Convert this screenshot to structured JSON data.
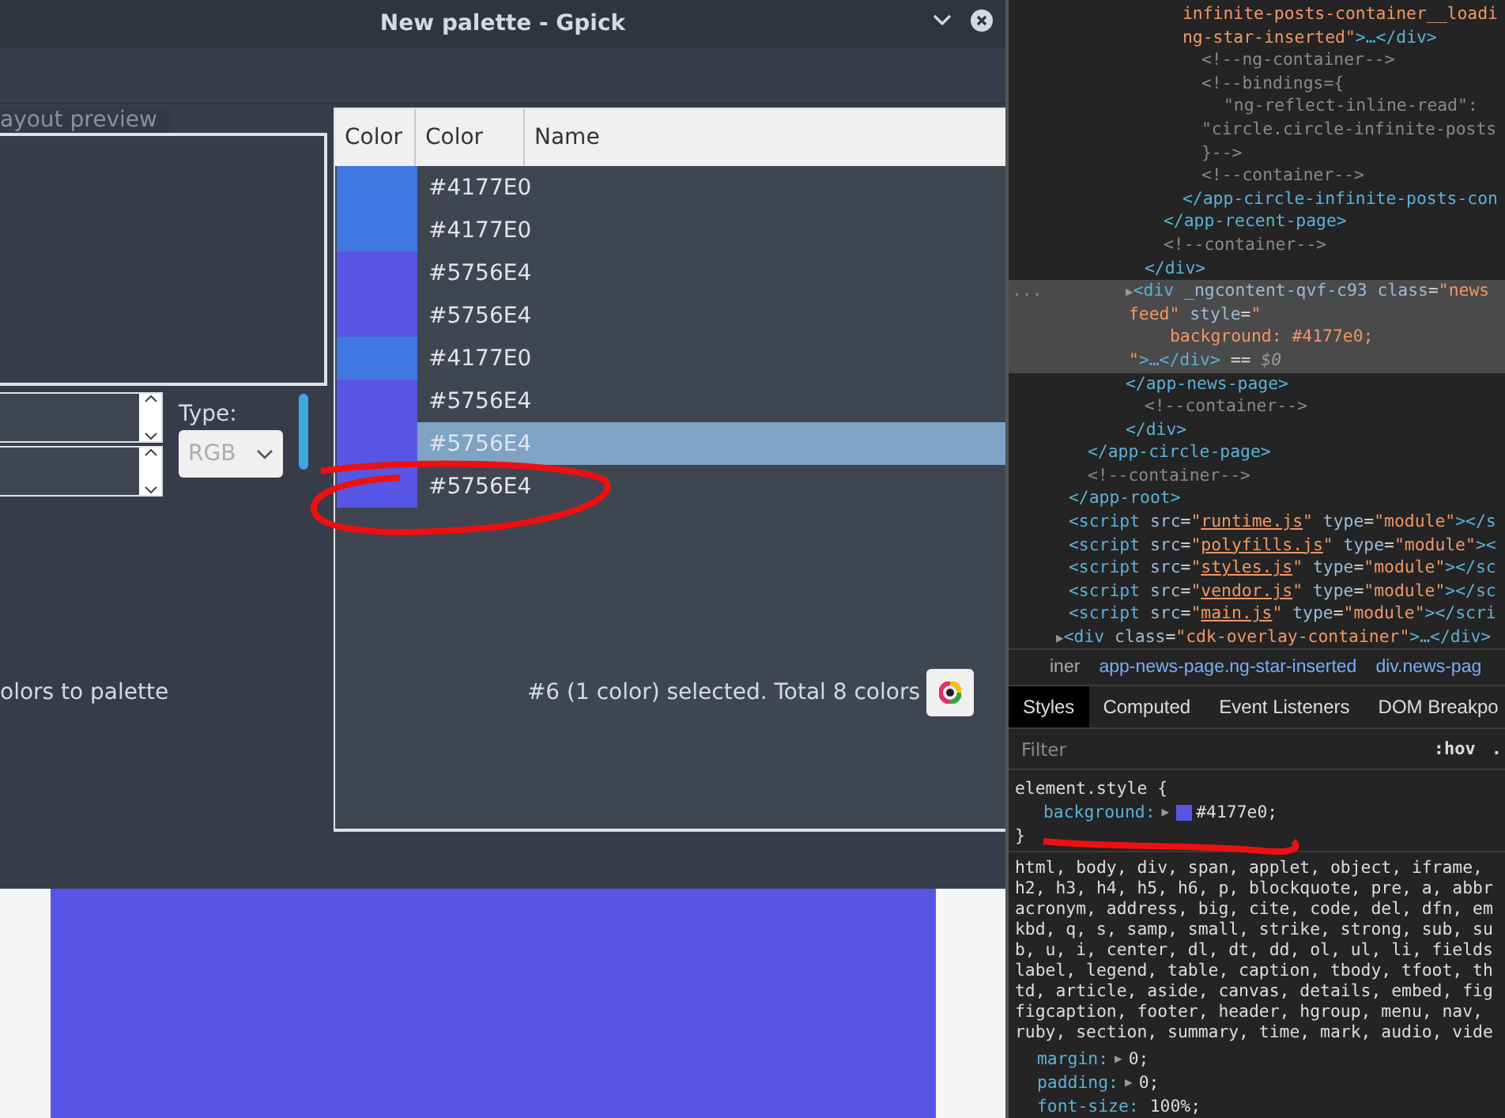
{
  "gpick": {
    "title": "New palette - Gpick",
    "preview_tab": {
      "label": "ayout preview",
      "selected": true
    },
    "type_label": "Type:",
    "type_select": {
      "value": "RGB",
      "disabled": true
    },
    "table": {
      "columns": [
        "Color",
        "Color",
        "Name"
      ],
      "rows": [
        {
          "color": "#4177e0",
          "value": "#4177E0",
          "selected": false
        },
        {
          "color": "#4177e0",
          "value": "#4177E0",
          "selected": false
        },
        {
          "color": "#5756e4",
          "value": "#5756E4",
          "selected": false
        },
        {
          "color": "#5756e4",
          "value": "#5756E4",
          "selected": false
        },
        {
          "color": "#4177e0",
          "value": "#4177E0",
          "selected": false
        },
        {
          "color": "#5756e4",
          "value": "#5756E4",
          "selected": false
        },
        {
          "color": "#5756e4",
          "value": "#5756E4",
          "selected": true
        },
        {
          "color": "#5756e4",
          "value": "#5756E4",
          "selected": false
        }
      ]
    },
    "status_left": "olors to palette",
    "status_right": "#6 (1 color) selected. Total 8 colors"
  },
  "devtools": {
    "elements": [
      {
        "tokens": [
          {
            "kind": "value",
            "text": "infinite-posts-container__loadi"
          }
        ]
      },
      {
        "tokens": [
          {
            "kind": "value",
            "text": "ng-star-inserted\""
          },
          {
            "kind": "tag",
            "text": ">…</div>"
          }
        ]
      },
      {
        "tokens": [
          {
            "kind": "comment",
            "text": "<!--ng-container-->"
          }
        ]
      },
      {
        "tokens": [
          {
            "kind": "comment",
            "text": "<!--bindings={"
          }
        ]
      },
      {
        "tokens": [
          {
            "kind": "comment",
            "text": "\"ng-reflect-inline-read\":"
          }
        ]
      },
      {
        "tokens": [
          {
            "kind": "comment",
            "text": "\"circle.circle-infinite-posts"
          }
        ]
      },
      {
        "tokens": [
          {
            "kind": "comment",
            "text": "}-->"
          }
        ]
      },
      {
        "tokens": [
          {
            "kind": "comment",
            "text": "<!--container-->"
          }
        ]
      },
      {
        "tokens": [
          {
            "kind": "tag",
            "text": "</app-circle-infinite-posts-con"
          }
        ]
      },
      {
        "tokens": [
          {
            "kind": "tag",
            "text": "</app-recent-page>"
          }
        ]
      },
      {
        "tokens": [
          {
            "kind": "comment",
            "text": "<!--container-->"
          }
        ]
      },
      {
        "tokens": [
          {
            "kind": "tag",
            "text": "</div>"
          }
        ]
      },
      {
        "selected": true,
        "gutter": "...",
        "tokens": [
          {
            "kind": "arrow",
            "text": "▶"
          },
          {
            "kind": "tag",
            "text": "<div "
          },
          {
            "kind": "attr",
            "text": "_ngcontent-qvf-c93 class"
          },
          {
            "kind": "plain",
            "text": "="
          },
          {
            "kind": "value",
            "text": "\"news"
          }
        ]
      },
      {
        "selected": true,
        "tokens": [
          {
            "kind": "value",
            "text": "feed\""
          },
          {
            "kind": "attr",
            "text": " style"
          },
          {
            "kind": "plain",
            "text": "="
          },
          {
            "kind": "value",
            "text": "\""
          }
        ]
      },
      {
        "selected": true,
        "tokens": [
          {
            "kind": "value",
            "text": "background: #4177e0;"
          }
        ]
      },
      {
        "selected": true,
        "tokens": [
          {
            "kind": "value",
            "text": "\""
          },
          {
            "kind": "tag",
            "text": ">…</div>"
          },
          {
            "kind": "plain",
            "text": " == "
          },
          {
            "kind": "dollar",
            "text": "$0"
          }
        ]
      },
      {
        "tokens": [
          {
            "kind": "tag",
            "text": "</app-news-page>"
          }
        ]
      },
      {
        "tokens": [
          {
            "kind": "comment",
            "text": "<!--container-->"
          }
        ]
      },
      {
        "tokens": [
          {
            "kind": "tag",
            "text": "</div>"
          }
        ]
      },
      {
        "tokens": [
          {
            "kind": "tag",
            "text": "</app-circle-page>"
          }
        ]
      },
      {
        "tokens": [
          {
            "kind": "comment",
            "text": "<!--container-->"
          }
        ]
      },
      {
        "tokens": [
          {
            "kind": "tag",
            "text": "</app-root>"
          }
        ]
      },
      {
        "tokens": [
          {
            "kind": "tag",
            "text": "<script "
          },
          {
            "kind": "attr",
            "text": "src"
          },
          {
            "kind": "plain",
            "text": "="
          },
          {
            "kind": "value",
            "text": "\""
          },
          {
            "kind": "link",
            "text": "runtime.js"
          },
          {
            "kind": "value",
            "text": "\""
          },
          {
            "kind": "attr",
            "text": " type"
          },
          {
            "kind": "plain",
            "text": "="
          },
          {
            "kind": "value",
            "text": "\"module\""
          },
          {
            "kind": "tag",
            "text": "></s"
          }
        ]
      },
      {
        "tokens": [
          {
            "kind": "tag",
            "text": "<script "
          },
          {
            "kind": "attr",
            "text": "src"
          },
          {
            "kind": "plain",
            "text": "="
          },
          {
            "kind": "value",
            "text": "\""
          },
          {
            "kind": "link",
            "text": "polyfills.js"
          },
          {
            "kind": "value",
            "text": "\""
          },
          {
            "kind": "attr",
            "text": " type"
          },
          {
            "kind": "plain",
            "text": "="
          },
          {
            "kind": "value",
            "text": "\"module\""
          },
          {
            "kind": "tag",
            "text": "><"
          }
        ]
      },
      {
        "tokens": [
          {
            "kind": "tag",
            "text": "<script "
          },
          {
            "kind": "attr",
            "text": "src"
          },
          {
            "kind": "plain",
            "text": "="
          },
          {
            "kind": "value",
            "text": "\""
          },
          {
            "kind": "link",
            "text": "styles.js"
          },
          {
            "kind": "value",
            "text": "\""
          },
          {
            "kind": "attr",
            "text": " type"
          },
          {
            "kind": "plain",
            "text": "="
          },
          {
            "kind": "value",
            "text": "\"module\""
          },
          {
            "kind": "tag",
            "text": "></sc"
          }
        ]
      },
      {
        "tokens": [
          {
            "kind": "tag",
            "text": "<script "
          },
          {
            "kind": "attr",
            "text": "src"
          },
          {
            "kind": "plain",
            "text": "="
          },
          {
            "kind": "value",
            "text": "\""
          },
          {
            "kind": "link",
            "text": "vendor.js"
          },
          {
            "kind": "value",
            "text": "\""
          },
          {
            "kind": "attr",
            "text": " type"
          },
          {
            "kind": "plain",
            "text": "="
          },
          {
            "kind": "value",
            "text": "\"module\""
          },
          {
            "kind": "tag",
            "text": "></sc"
          }
        ]
      },
      {
        "tokens": [
          {
            "kind": "tag",
            "text": "<script "
          },
          {
            "kind": "attr",
            "text": "src"
          },
          {
            "kind": "plain",
            "text": "="
          },
          {
            "kind": "value",
            "text": "\""
          },
          {
            "kind": "link",
            "text": "main.js"
          },
          {
            "kind": "value",
            "text": "\""
          },
          {
            "kind": "attr",
            "text": " type"
          },
          {
            "kind": "plain",
            "text": "="
          },
          {
            "kind": "value",
            "text": "\"module\""
          },
          {
            "kind": "tag",
            "text": "></scri"
          }
        ]
      },
      {
        "tokens": [
          {
            "kind": "arrow",
            "text": "▶"
          },
          {
            "kind": "tag",
            "text": "<div "
          },
          {
            "kind": "attr",
            "text": "class"
          },
          {
            "kind": "plain",
            "text": "="
          },
          {
            "kind": "value",
            "text": "\"cdk-overlay-container\""
          },
          {
            "kind": "tag",
            "text": ">…</div>"
          }
        ]
      }
    ],
    "breadcrumbs": [
      "iner",
      "app-news-page.ng-star-inserted",
      "div.news-pag"
    ],
    "tabs": [
      {
        "label": "Styles",
        "selected": true
      },
      {
        "label": "Computed",
        "selected": false
      },
      {
        "label": "Event Listeners",
        "selected": false
      },
      {
        "label": "DOM Breakpo",
        "selected": false
      }
    ],
    "filter": {
      "placeholder": "Filter"
    },
    "filter_buttons": [
      ":hov",
      "."
    ],
    "element_style": {
      "selector": "element.style {",
      "property": "background:",
      "arrow": "▶",
      "value": "#4177e0;",
      "close": "}"
    },
    "selectors": [
      "html, body, div, span, applet, object, iframe,",
      "h2, h3, h4, h5, h6, p, blockquote, pre, a, abbr",
      "acronym, address, big, cite, code, del, dfn, em",
      "kbd, q, s, samp, small, strike, strong, sub, su",
      "b, u, i, center, dl, dt, dd, ol, ul, li, fields",
      "label, legend, table, caption, tbody, tfoot, th",
      "td, article, aside, canvas, details, embed, fig",
      "figcaption, footer, header, hgroup, menu, nav,",
      "ruby, section, summary, time, mark, audio, vide"
    ],
    "declarations": [
      {
        "property": "margin:",
        "arrow": "▶",
        "value": "0;"
      },
      {
        "property": "padding:",
        "arrow": "▶",
        "value": "0;"
      },
      {
        "property": "font-size:",
        "value": "100%;"
      }
    ]
  }
}
